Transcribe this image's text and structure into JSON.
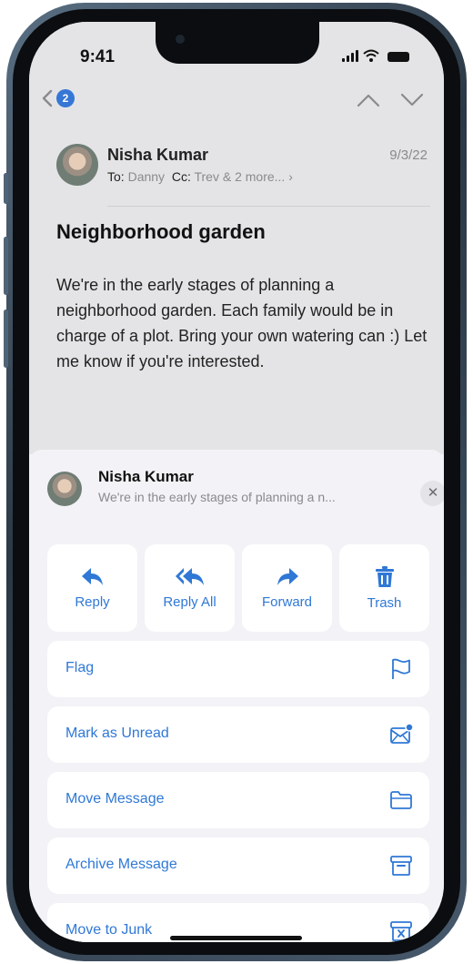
{
  "status": {
    "time": "9:41"
  },
  "nav": {
    "unread_count": "2"
  },
  "message": {
    "sender": "Nisha Kumar",
    "date": "9/3/22",
    "to_label": "To:",
    "to_value": "Danny",
    "cc_label": "Cc:",
    "cc_value": "Trev & 2 more...",
    "subject": "Neighborhood garden",
    "body": "We're in the early stages of planning a neighborhood garden. Each family would be in charge of a plot. Bring your own watering can :) Let me know if you're interested."
  },
  "sheet": {
    "sender": "Nisha Kumar",
    "preview": "We're in the early stages of planning a n...",
    "actions": [
      {
        "label": "Reply",
        "icon": "reply-icon"
      },
      {
        "label": "Reply All",
        "icon": "reply-all-icon"
      },
      {
        "label": "Forward",
        "icon": "forward-icon"
      },
      {
        "label": "Trash",
        "icon": "trash-icon"
      }
    ],
    "menu": [
      {
        "label": "Flag",
        "icon": "flag-icon"
      },
      {
        "label": "Mark as Unread",
        "icon": "unread-envelope-icon"
      },
      {
        "label": "Move Message",
        "icon": "folder-icon"
      },
      {
        "label": "Archive Message",
        "icon": "archive-box-icon"
      },
      {
        "label": "Move to Junk",
        "icon": "junk-box-icon"
      }
    ]
  },
  "colors": {
    "accent": "#2f78d6",
    "badge": "#3677d6",
    "sheet_bg": "#f2f2f7"
  }
}
